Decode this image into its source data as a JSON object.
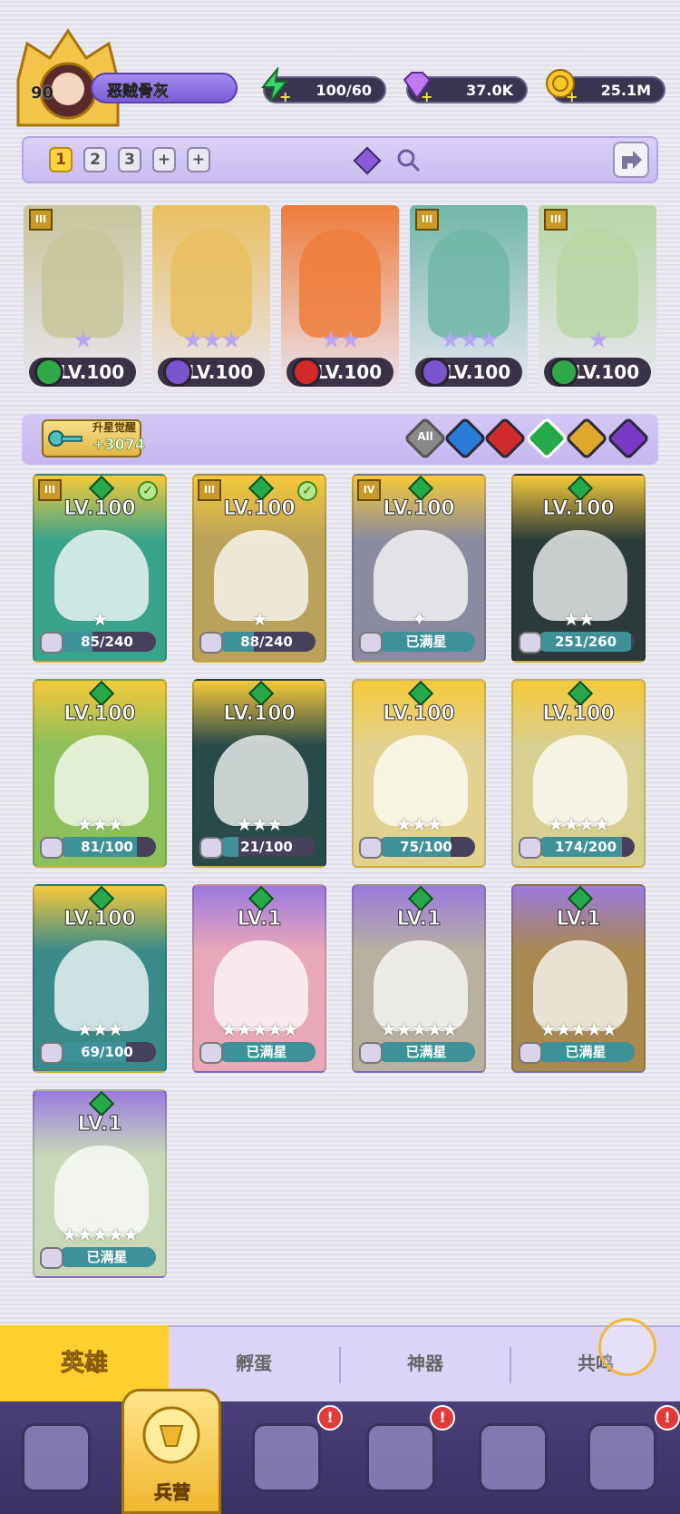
{
  "player": {
    "level": "90",
    "name": "恶贼骨灰"
  },
  "resources": {
    "energy": "100/60",
    "gems": "37.0K",
    "gold": "25.1M"
  },
  "team_slots": [
    "1",
    "2",
    "3",
    "+",
    "+"
  ],
  "active_slot": 0,
  "team_cards": [
    {
      "level": "LV.100",
      "stars": "★",
      "bg": "#c7c59a",
      "orb": "#2fa84a",
      "rank": "III"
    },
    {
      "level": "LV.100",
      "stars": "★★★",
      "bg": "#e7c060",
      "orb": "#7a55cc",
      "rank": ""
    },
    {
      "level": "LV.100",
      "stars": "★★",
      "bg": "#ee7c3a",
      "orb": "#d02a2a",
      "rank": ""
    },
    {
      "level": "LV.100",
      "stars": "★★★",
      "bg": "#6fb7a6",
      "orb": "#7a55cc",
      "rank": "III"
    },
    {
      "level": "LV.100",
      "stars": "★",
      "bg": "#b7d6a4",
      "orb": "#2fa84a",
      "rank": "III"
    }
  ],
  "upgrade": {
    "title": "升星觉醒",
    "value": "+3074"
  },
  "filters": {
    "all_label": "All"
  },
  "heroes": [
    {
      "level": "LV.100",
      "stars": "★",
      "progress": "85/240",
      "fill": 0.35,
      "bg": "#3aa38c",
      "rank": "III",
      "check": true
    },
    {
      "level": "LV.100",
      "stars": "★",
      "progress": "88/240",
      "fill": 0.37,
      "bg": "#b9a35a",
      "rank": "III",
      "check": true
    },
    {
      "level": "LV.100",
      "stars": "✦",
      "progress": "已满星",
      "fill": 1,
      "bg": "#8a8aa0",
      "rank": "IV",
      "check": false
    },
    {
      "level": "LV.100",
      "stars": "★★",
      "progress": "251/260",
      "fill": 0.96,
      "bg": "#2c3a3a",
      "rank": "",
      "check": false
    },
    {
      "level": "LV.100",
      "stars": "★★★",
      "progress": "81/100",
      "fill": 0.81,
      "bg": "#8dbf5a",
      "rank": "",
      "check": false
    },
    {
      "level": "LV.100",
      "stars": "★★★",
      "progress": "21/100",
      "fill": 0.21,
      "bg": "#2a4a4a",
      "rank": "",
      "check": false
    },
    {
      "level": "LV.100",
      "stars": "★★★",
      "progress": "75/100",
      "fill": 0.75,
      "bg": "#e2d290",
      "rank": "",
      "check": false
    },
    {
      "level": "LV.100",
      "stars": "★★★★",
      "progress": "174/200",
      "fill": 0.87,
      "bg": "#d8d090",
      "rank": "",
      "check": false
    },
    {
      "level": "LV.100",
      "stars": "★★★",
      "progress": "69/100",
      "fill": 0.69,
      "bg": "#3a8a8a",
      "rank": "",
      "check": false
    },
    {
      "level": "LV.1",
      "stars": "★★★★★",
      "progress": "已满星",
      "fill": 1,
      "bg": "#e8a8b8",
      "rank": "",
      "check": false
    },
    {
      "level": "LV.1",
      "stars": "★★★★★",
      "progress": "已满星",
      "fill": 1,
      "bg": "#b8b0a0",
      "rank": "",
      "check": false
    },
    {
      "level": "LV.1",
      "stars": "★★★★★",
      "progress": "已满星",
      "fill": 1,
      "bg": "#a88a50",
      "rank": "",
      "check": false
    },
    {
      "level": "LV.1",
      "stars": "★★★★★",
      "progress": "已满星",
      "fill": 1,
      "bg": "#c8d8b8",
      "rank": "",
      "check": false
    }
  ],
  "tabs": [
    "英雄",
    "孵蛋",
    "神器",
    "共鸣"
  ],
  "nav": {
    "active_label": "兵营",
    "badge": "!"
  }
}
